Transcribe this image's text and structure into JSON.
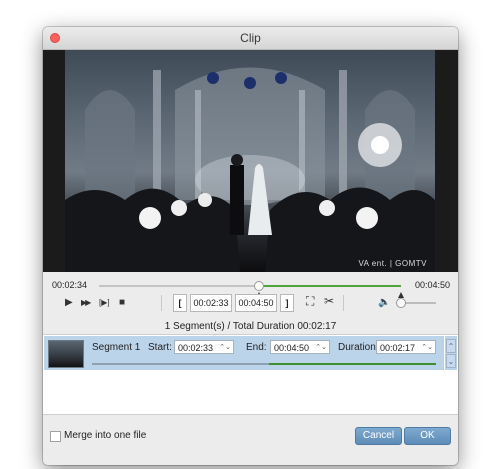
{
  "window": {
    "title": "Clip"
  },
  "video": {
    "watermark": "VA ent. | GOMTV"
  },
  "timeline": {
    "current_time": "00:02:34",
    "total_time": "00:04:50",
    "playhead_fraction": 0.53,
    "selection_start_fraction": 0.53,
    "selection_end_fraction": 1.0
  },
  "controls": {
    "play_icon": "▶",
    "fast_forward_icon": "▶▶",
    "frame_step_icon": "[▶]",
    "stop_icon": "■",
    "set_start_icon": "[",
    "set_end_icon": "]",
    "start_time": "00:02:33",
    "end_time": "00:04:50",
    "crop_icon": "⛶",
    "cut_icon": "✂",
    "volume_icon": "🔈",
    "volume_fraction": 0.1
  },
  "summary": "1 Segment(s) / Total Duration 00:02:17",
  "segment": {
    "name": "Segment 1",
    "start_label": "Start:",
    "start_value": "00:02:33",
    "end_label": "End:",
    "end_value": "00:04:50",
    "duration_label": "Duration:",
    "duration_value": "00:02:17",
    "spin_icon": "⌃⌄",
    "side_up": "⌃",
    "side_down": "⌄"
  },
  "footer": {
    "merge_label": "Merge into one file",
    "cancel_label": "Cancel",
    "ok_label": "OK"
  },
  "colors": {
    "accent": "#4fa53b",
    "selection": "#bcd4ea",
    "button": "#6d9ac4",
    "close": "#fc605c"
  }
}
